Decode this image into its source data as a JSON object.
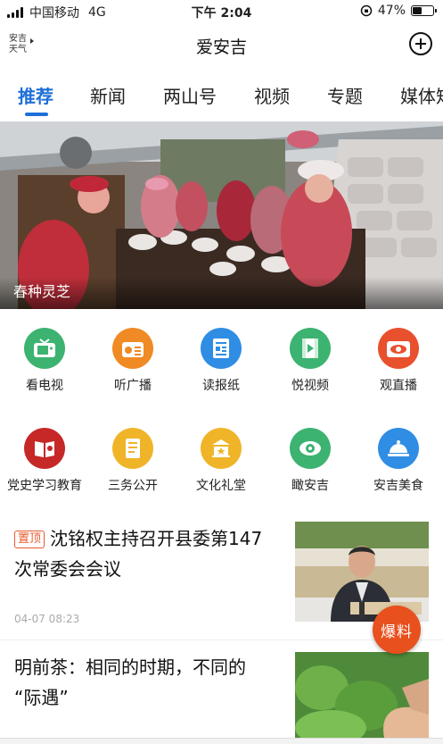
{
  "status_bar": {
    "carrier": "中国移动",
    "network": "4G",
    "time": "下午 2:04",
    "battery": "47%",
    "battery_level": 0.47
  },
  "header": {
    "weather_line1": "安吉",
    "weather_line2": "天气",
    "title": "爱安吉"
  },
  "tabs": [
    {
      "label": "推荐"
    },
    {
      "label": "新闻"
    },
    {
      "label": "两山号"
    },
    {
      "label": "视频"
    },
    {
      "label": "专题"
    },
    {
      "label": "媒体矩"
    }
  ],
  "banner": {
    "caption": "春种灵芝"
  },
  "shortcuts": [
    {
      "label": "看电视",
      "icon": "tv-icon",
      "color": "#3cb371"
    },
    {
      "label": "听广播",
      "icon": "radio-icon",
      "color": "#f08a24"
    },
    {
      "label": "读报纸",
      "icon": "newspaper-icon",
      "color": "#2f8de4"
    },
    {
      "label": "悦视频",
      "icon": "video-icon",
      "color": "#3cb371"
    },
    {
      "label": "观直播",
      "icon": "eye-icon",
      "color": "#e8502e"
    },
    {
      "label": "党史学习教育",
      "icon": "book-icon",
      "color": "#c62828"
    },
    {
      "label": "三务公开",
      "icon": "document-icon",
      "color": "#f0b429"
    },
    {
      "label": "文化礼堂",
      "icon": "hall-icon",
      "color": "#f0b429"
    },
    {
      "label": "瞰安吉",
      "icon": "lens-icon",
      "color": "#3cb371"
    },
    {
      "label": "安吉美食",
      "icon": "food-cover-icon",
      "color": "#2f8de4"
    }
  ],
  "feed": [
    {
      "badge": "置顶",
      "title_line1": "沈铭权主持召开县委第147",
      "title_line2": "次常委会会议",
      "time": "04-07 08:23"
    },
    {
      "title_line1": "明前茶：相同的时期，不同的",
      "title_line2": "“际遇”"
    }
  ],
  "floating_button": {
    "label": "爆料"
  }
}
